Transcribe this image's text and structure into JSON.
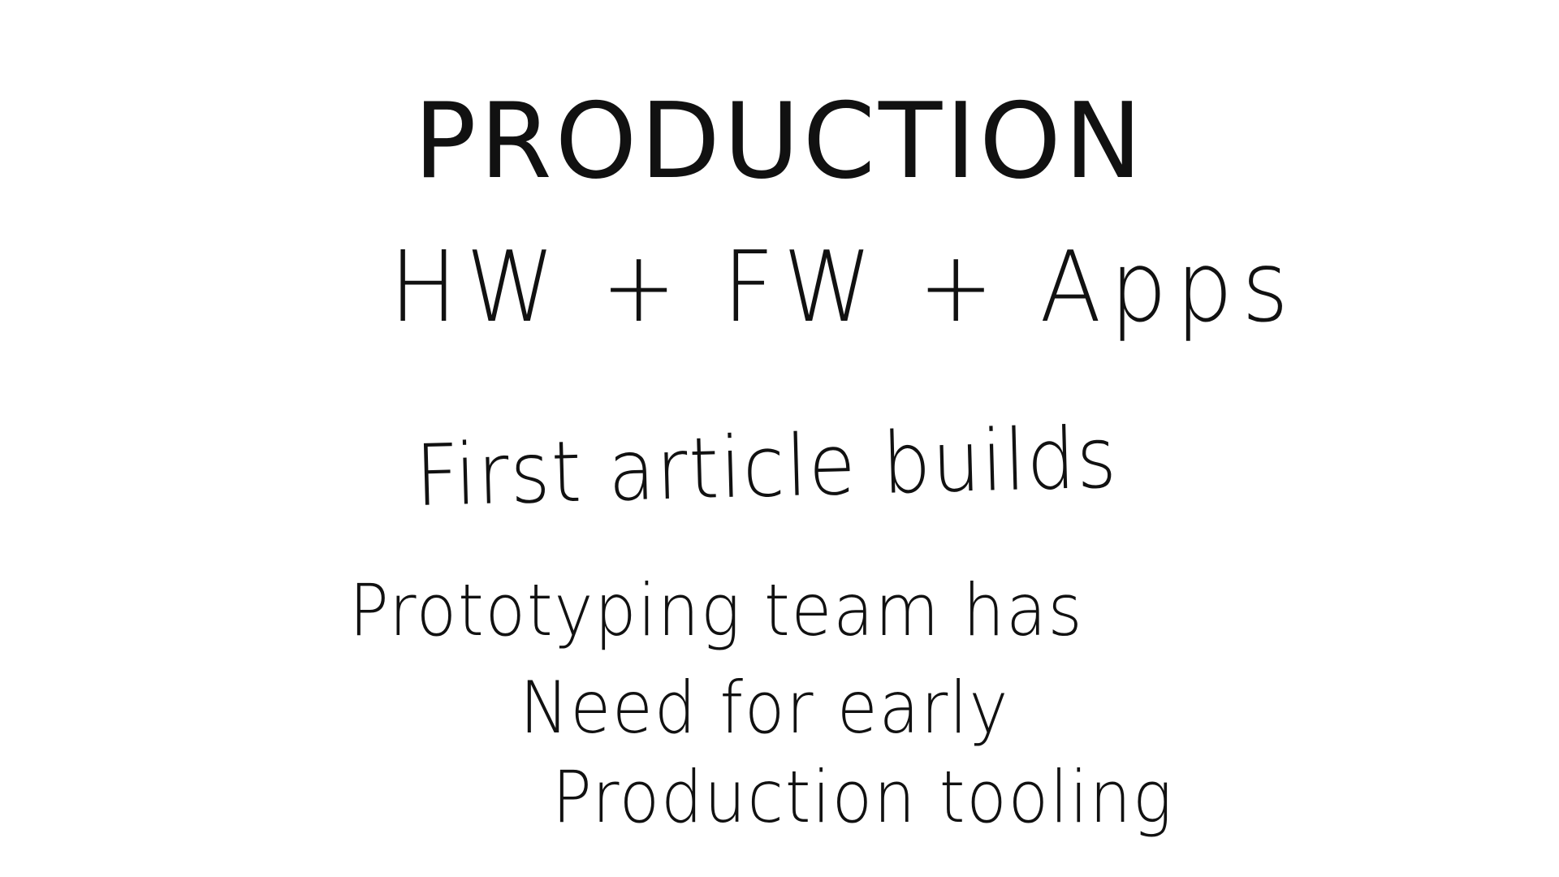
{
  "slide": {
    "title": "PRODUCTION",
    "lines": [
      "HW + FW + Apps",
      "First article builds",
      "Prototyping team has",
      "Need for early",
      "Production tooling"
    ]
  },
  "colors": {
    "background": "#ffffff",
    "text": "#111111"
  }
}
